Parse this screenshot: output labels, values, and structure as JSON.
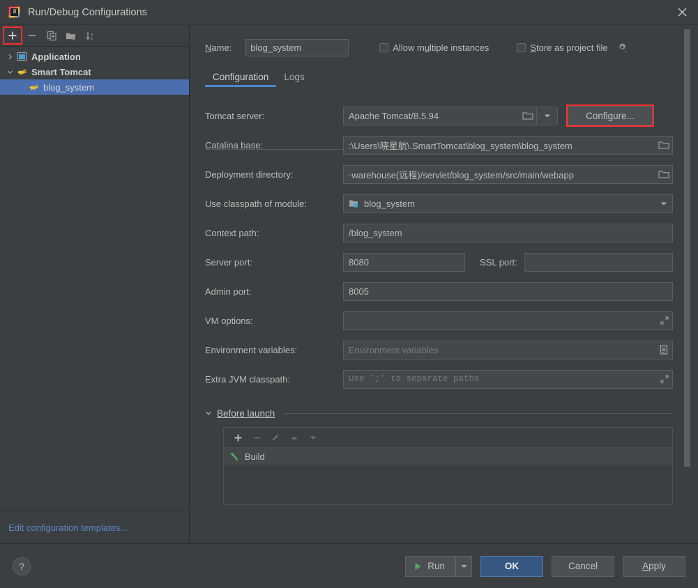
{
  "window": {
    "title": "Run/Debug Configurations",
    "logo_icon": "intellij-idea-logo",
    "close_icon": "close-icon"
  },
  "sidebar": {
    "toolbar": [
      {
        "name": "add-configuration-button",
        "icon": "plus-icon",
        "highlighted": true
      },
      {
        "name": "remove-configuration-button",
        "icon": "minus-icon",
        "highlighted": false
      },
      {
        "name": "copy-configuration-button",
        "icon": "copy-icon",
        "highlighted": false
      },
      {
        "name": "new-folder-button",
        "icon": "new-folder-icon",
        "highlighted": false
      },
      {
        "name": "sort-configurations-button",
        "icon": "sort-az-icon",
        "highlighted": false
      }
    ],
    "tree": [
      {
        "label": "Application",
        "icon": "application-icon",
        "expanded": false,
        "twisty": "chevron-right",
        "level": 0,
        "selected": false
      },
      {
        "label": "Smart Tomcat",
        "icon": "tomcat-icon",
        "expanded": true,
        "twisty": "chevron-down",
        "level": 0,
        "selected": false
      },
      {
        "label": "blog_system",
        "icon": "tomcat-icon",
        "level": 1,
        "selected": true
      }
    ],
    "edit_templates_link": "Edit configuration templates..."
  },
  "main": {
    "name_label": "Name:",
    "name_value": "blog_system",
    "checkboxes": [
      {
        "label": "Allow multiple instances",
        "checked": false
      },
      {
        "label": "Store as project file",
        "checked": false
      }
    ],
    "store_gear_icon": "gear-icon",
    "tabs": [
      {
        "label": "Configuration",
        "active": true
      },
      {
        "label": "Logs",
        "active": false
      }
    ],
    "fields": {
      "tomcat_server": {
        "label": "Tomcat server:",
        "value": "Apache Tomcat/8.5.94",
        "browse_icon": "folder-icon",
        "dropdown_icon": "chevron-down-icon"
      },
      "configure_button": {
        "label": "Configure...",
        "highlighted": true
      },
      "catalina_base": {
        "label": "Catalina base:",
        "value": ":\\Users\\晓星航\\.SmartTomcat\\blog_system\\blog_system",
        "browse_icon": "folder-icon"
      },
      "deployment_directory": {
        "label": "Deployment directory:",
        "value": "-warehouse(远程)/servlet/blog_system/src/main/webapp",
        "browse_icon": "folder-icon"
      },
      "use_classpath_of_module": {
        "label": "Use classpath of module:",
        "value": "blog_system",
        "module_icon": "module-icon",
        "dropdown_icon": "chevron-down-icon"
      },
      "context_path": {
        "label": "Context path:",
        "value": "/blog_system"
      },
      "server_port": {
        "label": "Server port:",
        "value": "8080"
      },
      "ssl_port": {
        "label": "SSL port:",
        "value": ""
      },
      "admin_port": {
        "label": "Admin port:",
        "value": "8005"
      },
      "vm_options": {
        "label": "VM options:",
        "value": "",
        "expand_icon": "expand-icon"
      },
      "environment_variables": {
        "label": "Environment variables:",
        "value": "",
        "placeholder": "Environment variables",
        "edit_icon": "list-edit-icon"
      },
      "extra_jvm_classpath": {
        "label": "Extra JVM classpath:",
        "value": "",
        "placeholder": "Use ';' to separate paths",
        "expand_icon": "expand-icon"
      }
    },
    "before_launch": {
      "title": "Before launch",
      "twisty": "chevron-down",
      "toolbar": [
        {
          "name": "add-task-button",
          "icon": "plus-icon",
          "enabled": true
        },
        {
          "name": "remove-task-button",
          "icon": "minus-icon",
          "enabled": false
        },
        {
          "name": "edit-task-button",
          "icon": "pencil-icon",
          "enabled": false
        },
        {
          "name": "move-task-up-button",
          "icon": "triangle-up-icon",
          "enabled": false
        },
        {
          "name": "move-task-down-button",
          "icon": "triangle-down-icon",
          "enabled": false
        }
      ],
      "items": [
        {
          "label": "Build",
          "icon": "build-hammer-icon"
        }
      ]
    }
  },
  "footer": {
    "help_label": "?",
    "run_label": "Run",
    "run_icon": "play-icon",
    "run_dropdown_icon": "chevron-down-icon",
    "ok_label": "OK",
    "cancel_label": "Cancel",
    "apply_label": "Apply"
  },
  "colors": {
    "background": "#3c3f41",
    "field_background": "#45484a",
    "selection_blue": "#4b6eaf",
    "accent_blue": "#4a88c7",
    "primary_button": "#365880",
    "highlight_red": "#ff2d2d",
    "link_blue": "#5c84c8",
    "text": "#bbbbbb"
  }
}
